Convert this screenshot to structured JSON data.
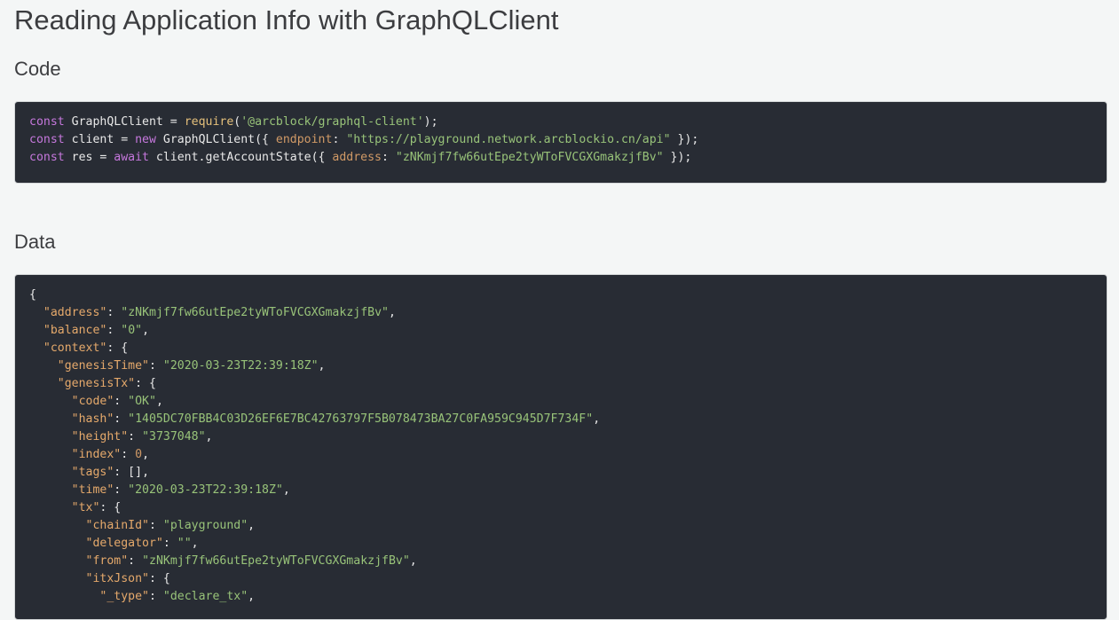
{
  "page": {
    "title": "Reading Application Info with GraphQLClient"
  },
  "code_section": {
    "heading": "Code",
    "lines": [
      {
        "t1": "const",
        "t2": " GraphQLClient = ",
        "t3": "require",
        "t4": "(",
        "t5": "'@arcblock/graphql-client'",
        "t6": ");"
      },
      {
        "t1": "const",
        "t2": " client = ",
        "t3": "new",
        "t4": " GraphQLClient({ ",
        "t5": "endpoint",
        "t6": ": ",
        "t7": "\"https://playground.network.arcblockio.cn/api\"",
        "t8": " });"
      },
      {
        "t1": "const",
        "t2": " res = ",
        "t3": "await",
        "t4": " client.getAccountState({ ",
        "t5": "address",
        "t6": ": ",
        "t7": "\"zNKmjf7fw66utEpe2tyWToFVCGXGmakzjfBv\"",
        "t8": " });"
      }
    ]
  },
  "data_section": {
    "heading": "Data",
    "lines": [
      {
        "indent": "",
        "key": "",
        "sep": "{",
        "val": "",
        "val_type": "punc",
        "tail": ""
      },
      {
        "indent": "  ",
        "key": "\"address\"",
        "sep": ": ",
        "val": "\"zNKmjf7fw66utEpe2tyWToFVCGXGmakzjfBv\"",
        "val_type": "str",
        "tail": ","
      },
      {
        "indent": "  ",
        "key": "\"balance\"",
        "sep": ": ",
        "val": "\"0\"",
        "val_type": "str",
        "tail": ","
      },
      {
        "indent": "  ",
        "key": "\"context\"",
        "sep": ": ",
        "val": "{",
        "val_type": "punc",
        "tail": ""
      },
      {
        "indent": "    ",
        "key": "\"genesisTime\"",
        "sep": ": ",
        "val": "\"2020-03-23T22:39:18Z\"",
        "val_type": "str",
        "tail": ","
      },
      {
        "indent": "    ",
        "key": "\"genesisTx\"",
        "sep": ": ",
        "val": "{",
        "val_type": "punc",
        "tail": ""
      },
      {
        "indent": "      ",
        "key": "\"code\"",
        "sep": ": ",
        "val": "\"OK\"",
        "val_type": "str",
        "tail": ","
      },
      {
        "indent": "      ",
        "key": "\"hash\"",
        "sep": ": ",
        "val": "\"1405DC70FBB4C03D26EF6E7BC42763797F5B078473BA27C0FA959C945D7F734F\"",
        "val_type": "str",
        "tail": ","
      },
      {
        "indent": "      ",
        "key": "\"height\"",
        "sep": ": ",
        "val": "\"3737048\"",
        "val_type": "str",
        "tail": ","
      },
      {
        "indent": "      ",
        "key": "\"index\"",
        "sep": ": ",
        "val": "0",
        "val_type": "num",
        "tail": ","
      },
      {
        "indent": "      ",
        "key": "\"tags\"",
        "sep": ": ",
        "val": "[]",
        "val_type": "punc",
        "tail": ","
      },
      {
        "indent": "      ",
        "key": "\"time\"",
        "sep": ": ",
        "val": "\"2020-03-23T22:39:18Z\"",
        "val_type": "str",
        "tail": ","
      },
      {
        "indent": "      ",
        "key": "\"tx\"",
        "sep": ": ",
        "val": "{",
        "val_type": "punc",
        "tail": ""
      },
      {
        "indent": "        ",
        "key": "\"chainId\"",
        "sep": ": ",
        "val": "\"playground\"",
        "val_type": "str",
        "tail": ","
      },
      {
        "indent": "        ",
        "key": "\"delegator\"",
        "sep": ": ",
        "val": "\"\"",
        "val_type": "str",
        "tail": ","
      },
      {
        "indent": "        ",
        "key": "\"from\"",
        "sep": ": ",
        "val": "\"zNKmjf7fw66utEpe2tyWToFVCGXGmakzjfBv\"",
        "val_type": "str",
        "tail": ","
      },
      {
        "indent": "        ",
        "key": "\"itxJson\"",
        "sep": ": ",
        "val": "{",
        "val_type": "punc",
        "tail": ""
      },
      {
        "indent": "          ",
        "key": "\"_type\"",
        "sep": ": ",
        "val": "\"declare_tx\"",
        "val_type": "str",
        "tail": ","
      }
    ]
  }
}
